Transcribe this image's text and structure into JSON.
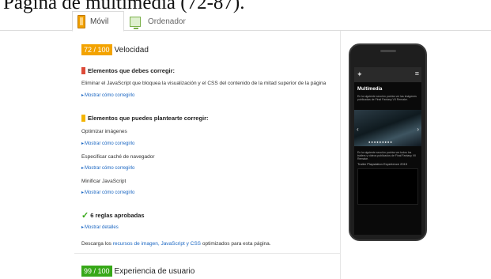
{
  "caption": "Página de multimedia (72-87).",
  "tabs": [
    {
      "label": "Móvil",
      "active": true
    },
    {
      "label": "Ordenador",
      "active": false
    }
  ],
  "speed": {
    "score": "72 / 100",
    "label": "Velocidad"
  },
  "must_fix": {
    "title": "Elementos que debes corregir:",
    "text": "Eliminar el JavaScript que bloquea la visualización y el CSS del contenido de la mitad superior de la página",
    "link": "Mostrar cómo corregirlo"
  },
  "consider_fix": {
    "title": "Elementos que puedes plantearte corregir:",
    "items": [
      {
        "text": "Optimizar imágenes",
        "link": "Mostrar cómo corregirlo"
      },
      {
        "text": "Especificar caché de navegador",
        "link": "Mostrar cómo corregirlo"
      },
      {
        "text": "Minificar JavaScript",
        "link": "Mostrar cómo corregirlo"
      }
    ]
  },
  "passed": {
    "title": "6 reglas aprobadas",
    "link": "Mostrar detalles"
  },
  "download": {
    "prefix": "Descarga los",
    "link": "recursos de imagen, JavaScript y CSS",
    "suffix": "optimizados para esta página."
  },
  "ux": {
    "score": "99 / 100",
    "label": "Experiencia de usuario"
  },
  "preview": {
    "menu_icon": "≡",
    "title": "Multimedia",
    "subtitle": "En la siguiente sección podrás ver las imágenes publicadas de Final Fantasy VII Remake.",
    "subtitle2": "En la siguiente sección podrás ver todos los trailers y videos publicados de Final Fantasy VII Remake.",
    "video_title": "Trailer Playstation Experience 2015"
  },
  "colors": {
    "orange": "#f3a300",
    "green": "#37a818",
    "red": "#dd4b39",
    "link": "#1a66c2"
  }
}
